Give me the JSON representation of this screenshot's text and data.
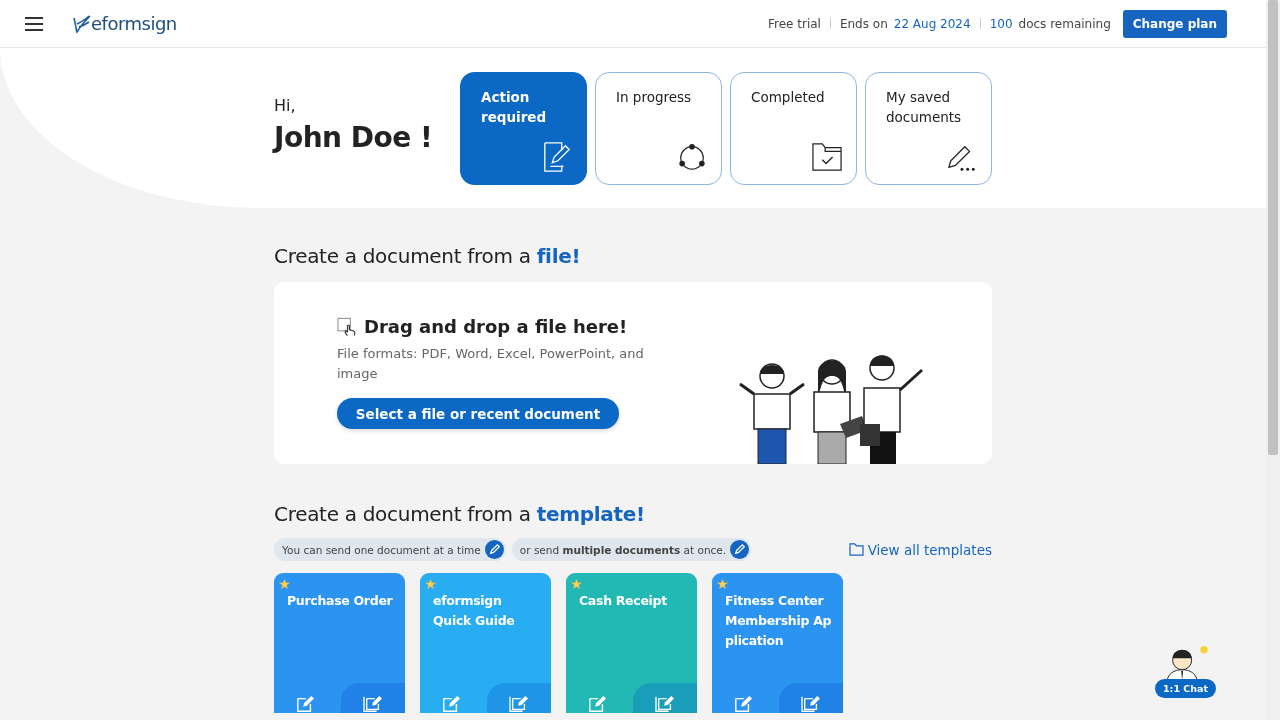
{
  "header": {
    "logo": "eformsign",
    "trial": "Free trial",
    "ends_label": "Ends on",
    "ends_date": "22 Aug 2024",
    "docs_count": "100",
    "docs_label": "docs remaining",
    "button": "Change plan"
  },
  "greeting": {
    "hi": "Hi,",
    "name": "John Doe !"
  },
  "status_cards": [
    {
      "label": "Action required",
      "kind": "action",
      "selected": true
    },
    {
      "label": "In progress",
      "kind": "progress",
      "selected": false
    },
    {
      "label": "Completed",
      "kind": "completed",
      "selected": false
    },
    {
      "label": "My saved documents",
      "kind": "saved",
      "selected": false
    }
  ],
  "file_section": {
    "title": "Create a document from a **file!**",
    "drop_title": "Drag and drop a file here!",
    "formats": "File formats: PDF, Word, Excel, PowerPoint, and image",
    "button": "Select a file or recent document"
  },
  "template_section": {
    "title": "Create a document from a **template!**",
    "hint_single": "You can send one document at a time",
    "hint_multiple": "or send **multiple documents** at once.",
    "view_all": "View all templates"
  },
  "templates": [
    {
      "name": "Purchase Order",
      "color": "#2b93f0"
    },
    {
      "name": "eformsign Quick Guide",
      "color": "#28acf2"
    },
    {
      "name": "Cash Receipt",
      "color": "#22b8b4"
    },
    {
      "name": "Fitness Center Membership Ap plication",
      "color": "#2b93f0"
    }
  ],
  "chat": {
    "label": "1:1 Chat"
  }
}
